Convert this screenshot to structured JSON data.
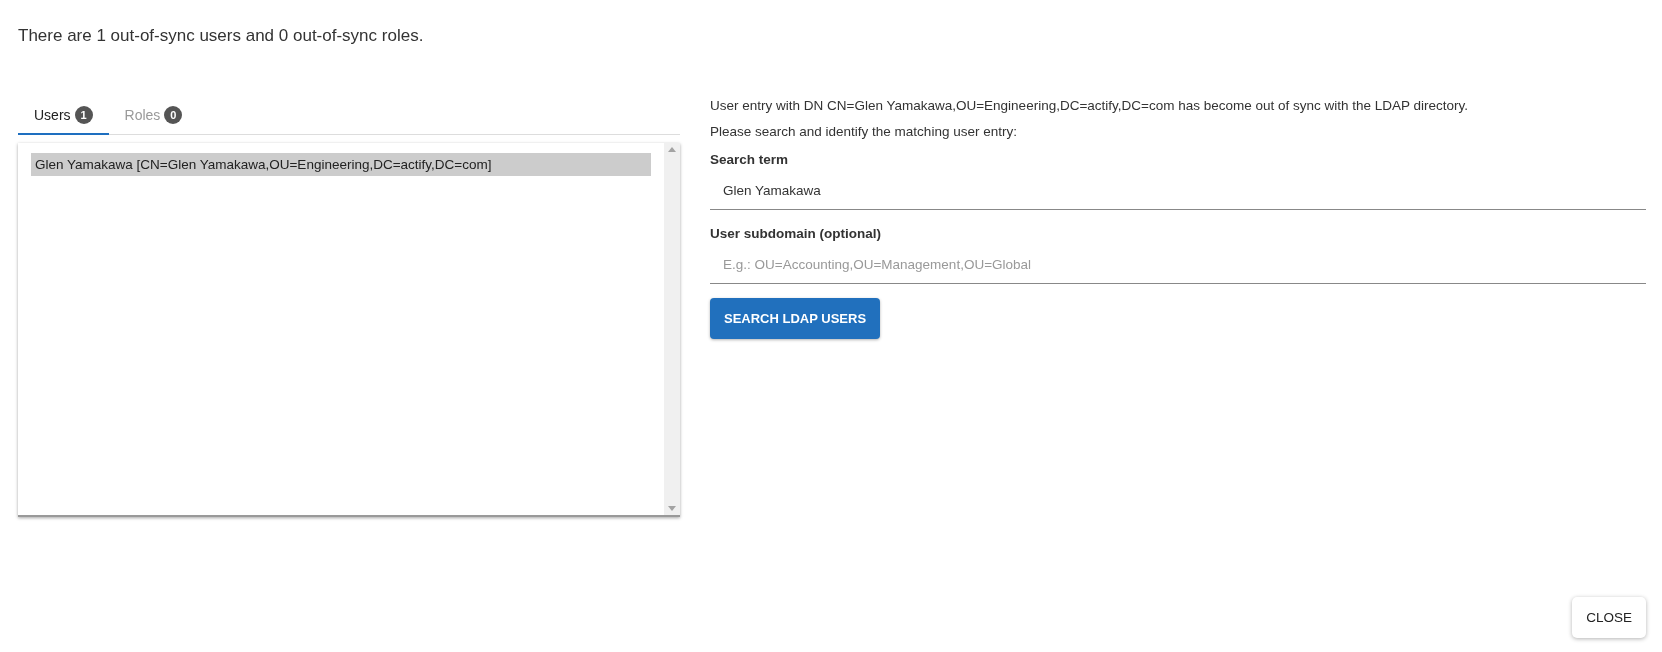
{
  "summary": "There are 1 out-of-sync users and 0 out-of-sync roles.",
  "tabs": [
    {
      "label": "Users",
      "count": "1",
      "selected": true
    },
    {
      "label": "Roles",
      "count": "0",
      "selected": false
    }
  ],
  "entries": [
    {
      "label": "Glen Yamakawa [CN=Glen Yamakawa,OU=Engineering,DC=actify,DC=com]",
      "selected": true
    }
  ],
  "message": "User entry with DN CN=Glen Yamakawa,OU=Engineering,DC=actify,DC=com has become out of sync with the LDAP directory.",
  "prompt": "Please search and identify the matching user entry:",
  "fields": [
    {
      "label": "Search term",
      "value": "Glen Yamakawa"
    },
    {
      "label": "User subdomain (optional)",
      "placeholder": "E.g.: OU=Accounting,OU=Management,OU=Global"
    }
  ],
  "search_button": "SEARCH LDAP USERS",
  "close_button": "CLOSE"
}
